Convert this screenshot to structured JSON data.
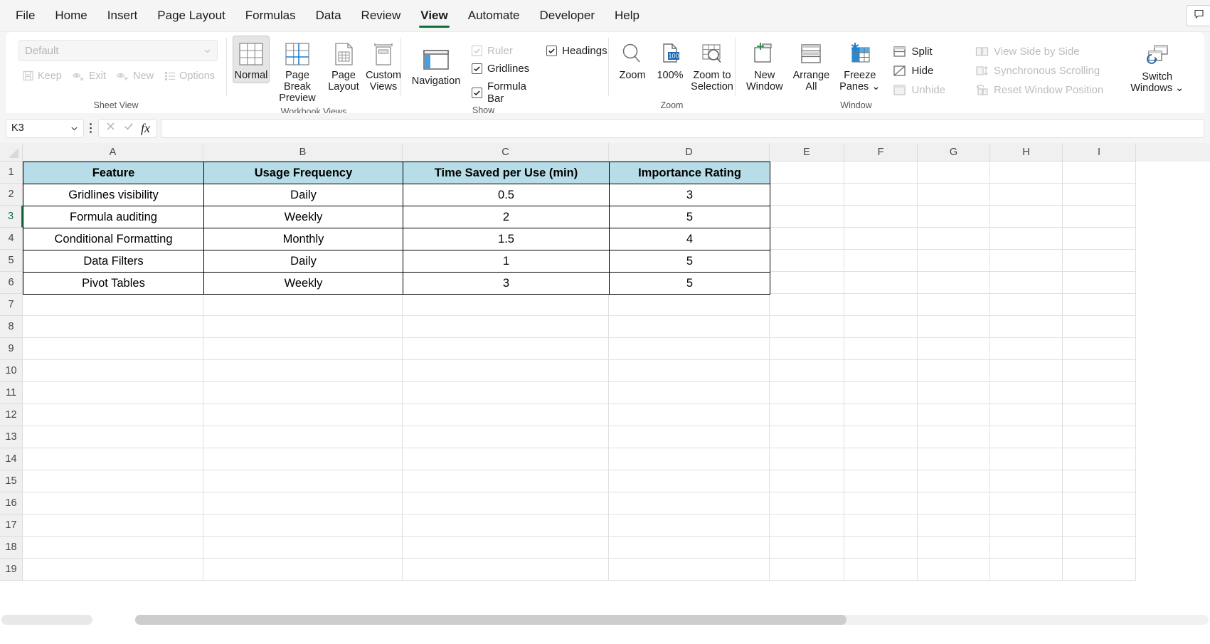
{
  "tabs": [
    {
      "label": "File",
      "active": false
    },
    {
      "label": "Home",
      "active": false
    },
    {
      "label": "Insert",
      "active": false
    },
    {
      "label": "Page Layout",
      "active": false
    },
    {
      "label": "Formulas",
      "active": false
    },
    {
      "label": "Data",
      "active": false
    },
    {
      "label": "Review",
      "active": false
    },
    {
      "label": "View",
      "active": true
    },
    {
      "label": "Automate",
      "active": false
    },
    {
      "label": "Developer",
      "active": false
    },
    {
      "label": "Help",
      "active": false
    }
  ],
  "comment_button": {
    "label": "C",
    "icon": "comment-icon"
  },
  "accent": {
    "tab_underline": "#12703a",
    "header_fill": "#b7dde8",
    "selection_green": "#127245"
  },
  "ribbon": {
    "sheet_view": {
      "group_label": "Sheet View",
      "combo_value": "Default",
      "items": [
        {
          "label": "Keep",
          "icon": "save-icon",
          "disabled": true
        },
        {
          "label": "Exit",
          "icon": "eye-exit-icon",
          "disabled": true
        },
        {
          "label": "New",
          "icon": "eye-new-icon",
          "disabled": true
        },
        {
          "label": "Options",
          "icon": "options-list-icon",
          "disabled": true
        }
      ]
    },
    "workbook_views": {
      "group_label": "Workbook Views",
      "items": [
        {
          "label": "Normal",
          "icon": "normal-view-icon",
          "selected": true
        },
        {
          "label": "Page Break\nPreview",
          "icon": "page-break-preview-icon",
          "selected": false
        },
        {
          "label": "Page\nLayout",
          "icon": "page-layout-icon",
          "selected": false
        },
        {
          "label": "Custom\nViews",
          "icon": "custom-views-icon",
          "selected": false
        }
      ]
    },
    "show": {
      "group_label": "Show",
      "navigation": {
        "label": "Navigation",
        "icon": "navigation-pane-icon"
      },
      "checks": [
        {
          "label": "Ruler",
          "checked": true,
          "disabled": true
        },
        {
          "label": "Gridlines",
          "checked": true,
          "disabled": false
        },
        {
          "label": "Formula Bar",
          "checked": true,
          "disabled": false
        },
        {
          "label": "Headings",
          "checked": true,
          "disabled": false
        }
      ]
    },
    "zoom": {
      "group_label": "Zoom",
      "items": [
        {
          "label": "Zoom",
          "icon": "magnifier-icon"
        },
        {
          "label": "100%",
          "icon": "zoom-100-icon"
        },
        {
          "label": "Zoom to\nSelection",
          "icon": "zoom-to-selection-icon"
        }
      ]
    },
    "window": {
      "group_label": "Window",
      "big_items": [
        {
          "label": "New\nWindow",
          "icon": "new-window-icon"
        },
        {
          "label": "Arrange\nAll",
          "icon": "arrange-all-icon"
        },
        {
          "label": "Freeze\nPanes ⌄",
          "icon": "freeze-panes-icon"
        }
      ],
      "small_items": [
        {
          "label": "Split",
          "icon": "split-icon",
          "disabled": false
        },
        {
          "label": "Hide",
          "icon": "hide-icon",
          "disabled": false
        },
        {
          "label": "Unhide",
          "icon": "unhide-icon",
          "disabled": true
        }
      ],
      "side_items": [
        {
          "label": "View Side by Side",
          "icon": "view-side-by-side-icon",
          "disabled": true
        },
        {
          "label": "Synchronous Scrolling",
          "icon": "synchronous-scrolling-icon",
          "disabled": true
        },
        {
          "label": "Reset Window Position",
          "icon": "reset-window-position-icon",
          "disabled": true
        }
      ],
      "switch_windows": {
        "label": "Switch\nWindows ⌄",
        "icon": "switch-windows-icon"
      }
    }
  },
  "formula_bar": {
    "name_box_value": "K3",
    "cancel_icon": "cancel-x-icon",
    "enter_icon": "enter-check-icon",
    "function_icon": "insert-function-fx-icon",
    "formula_value": ""
  },
  "grid": {
    "column_headers": [
      "A",
      "B",
      "C",
      "D",
      "E",
      "F",
      "G",
      "H",
      "I"
    ],
    "row_headers": [
      "1",
      "2",
      "3",
      "4",
      "5",
      "6",
      "7",
      "8",
      "9",
      "10",
      "11",
      "12",
      "13",
      "14",
      "15",
      "16",
      "17",
      "18",
      "19"
    ],
    "active_row": "3",
    "table_headers": [
      "Feature",
      "Usage Frequency",
      "Time Saved per Use (min)",
      "Importance Rating"
    ],
    "table_rows": [
      [
        "Gridlines visibility",
        "Daily",
        "0.5",
        "3"
      ],
      [
        "Formula auditing",
        "Weekly",
        "2",
        "5"
      ],
      [
        "Conditional Formatting",
        "Monthly",
        "1.5",
        "4"
      ],
      [
        "Data Filters",
        "Daily",
        "1",
        "5"
      ],
      [
        "Pivot Tables",
        "Weekly",
        "3",
        "5"
      ]
    ]
  }
}
